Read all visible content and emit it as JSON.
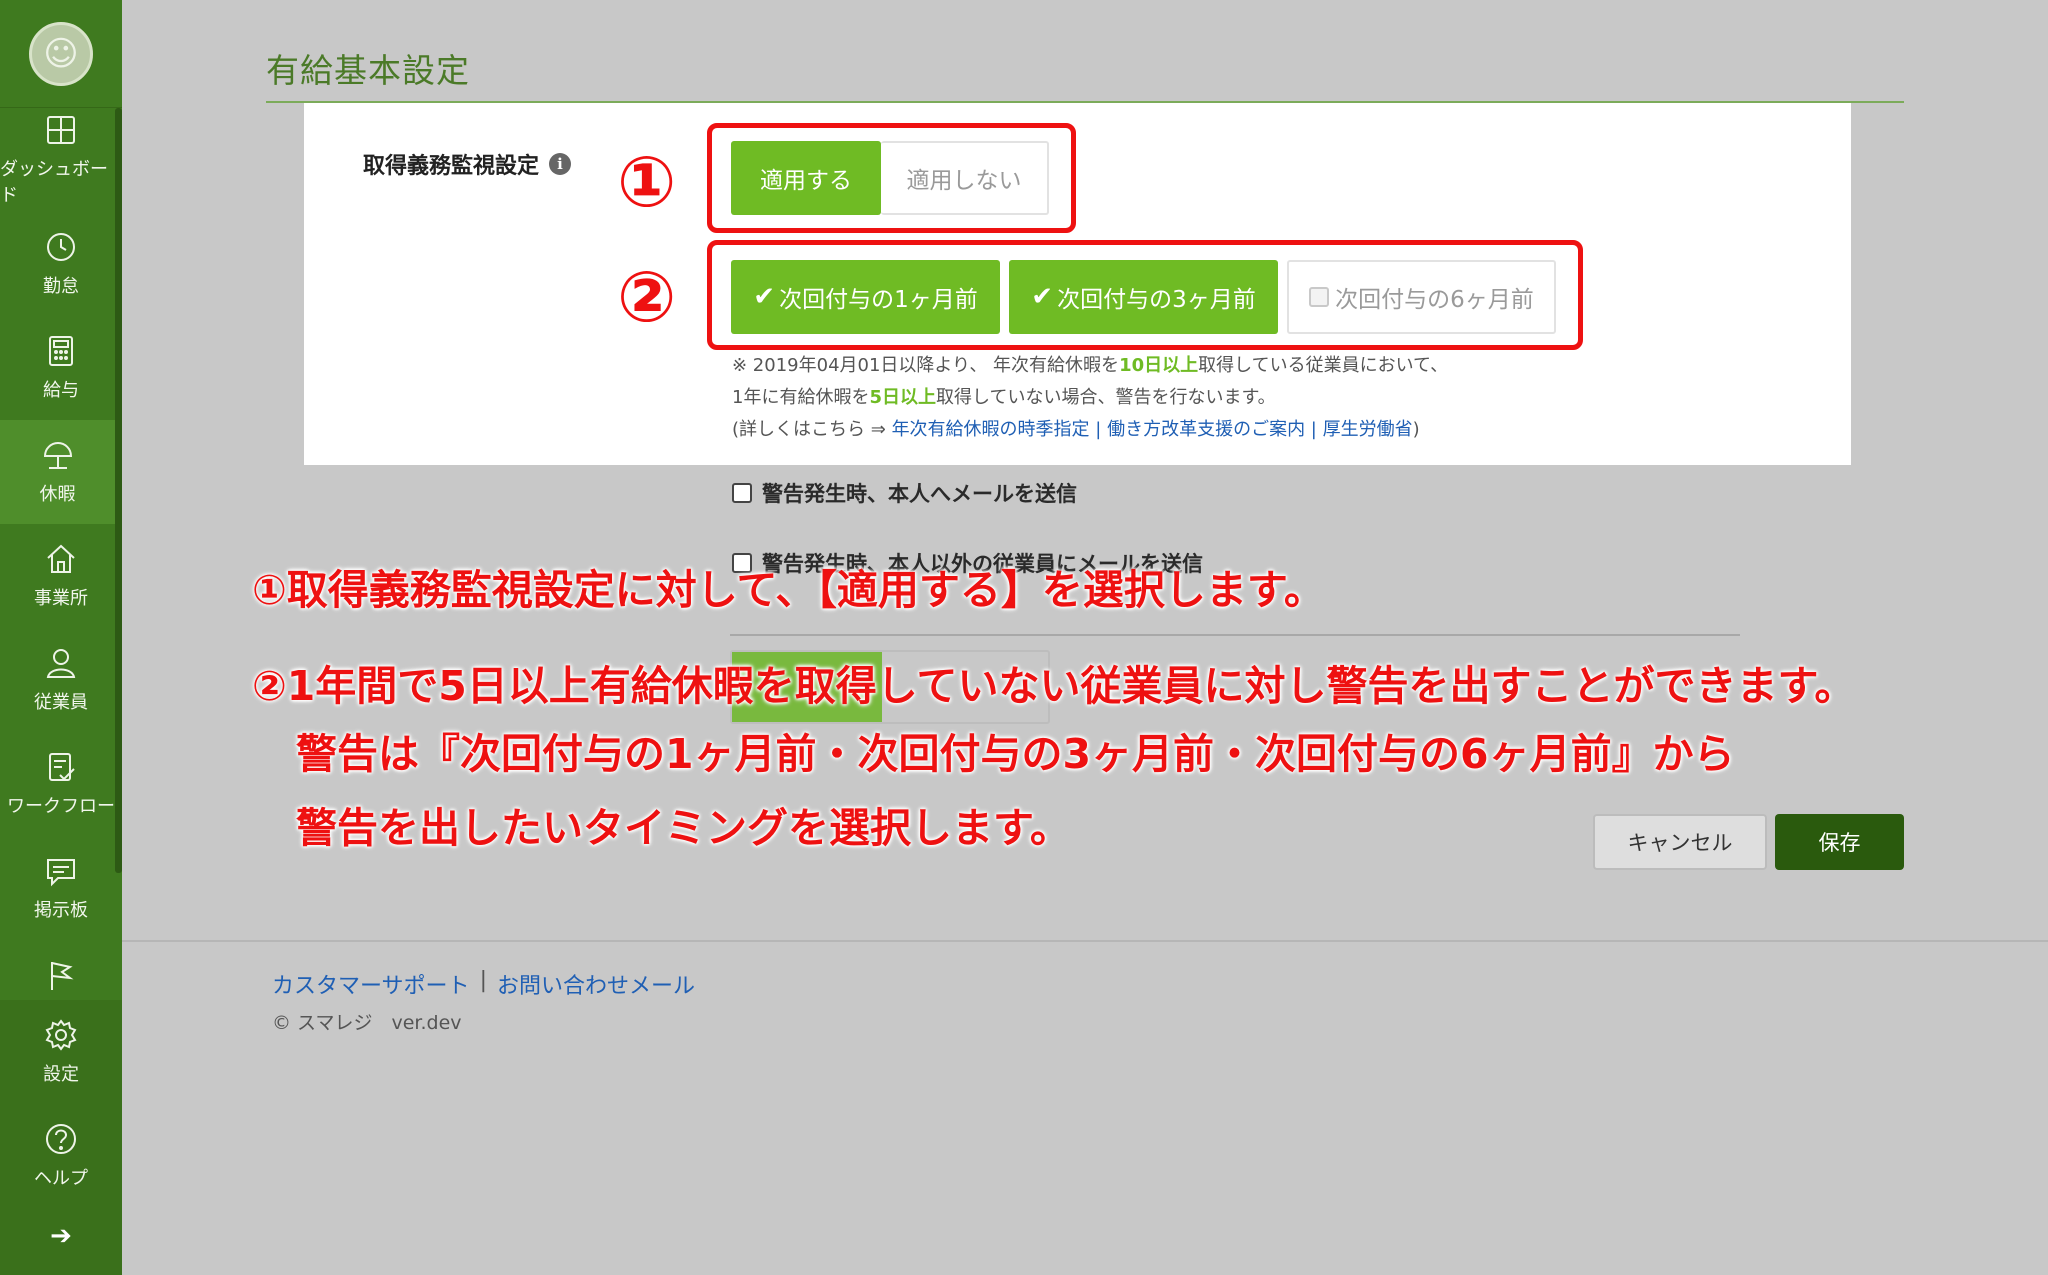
{
  "sidebar": {
    "items": [
      {
        "label": "ダッシュボード",
        "icon": "dashboard-icon"
      },
      {
        "label": "勤怠",
        "icon": "clock-icon"
      },
      {
        "label": "給与",
        "icon": "calculator-icon"
      },
      {
        "label": "休暇",
        "icon": "umbrella-icon"
      },
      {
        "label": "事業所",
        "icon": "home-icon"
      },
      {
        "label": "従業員",
        "icon": "person-icon"
      },
      {
        "label": "ワークフロー",
        "icon": "checklist-icon"
      },
      {
        "label": "掲示板",
        "icon": "message-icon"
      },
      {
        "label": "",
        "icon": "flag-icon"
      },
      {
        "label": "設定",
        "icon": "gear-icon"
      },
      {
        "label": "ヘルプ",
        "icon": "help-icon"
      }
    ],
    "collapse_icon": "arrow-right-icon"
  },
  "page": {
    "title": "有給基本設定"
  },
  "form": {
    "monitor_label": "取得義務監視設定",
    "apply_label": "適用する",
    "not_apply_label": "適用しない",
    "timing": {
      "one_month": "次回付与の1ヶ月前",
      "three_month": "次回付与の3ヶ月前",
      "six_month": "次回付与の6ヶ月前"
    },
    "note": {
      "line1_a": "※ 2019年04月01日以降より、 年次有給休暇を",
      "line1_hl": "10日以上",
      "line1_b": "取得している従業員において、",
      "line2_a": "1年に有給休暇を",
      "line2_hl": "5日以上",
      "line2_b": "取得していない場合、警告を行ないます。",
      "line3_a": "(詳しくはこちら ⇒ ",
      "link1": "年次有給休暇の時季指定",
      "link_sep": " | ",
      "link2": "働き方改革支援のご案内",
      "link3": "厚生労働省",
      "line3_b": ")"
    },
    "mail_self": "警告発生時、本人へメールを送信",
    "mail_others": "警告発生時、本人以外の従業員にメールを送信",
    "cancel": "キャンセル",
    "save": "保存"
  },
  "footer": {
    "support": "カスタマーサポート",
    "sep": "|",
    "contact": "お問い合わせメール",
    "copyright": "© スマレジ　ver.dev"
  },
  "annotations": {
    "num1": "①",
    "num2": "②",
    "line1": "①取得義務監視設定に対して、【適用する】を選択します。",
    "line2": "②1年間で5日以上有給休暇を取得していない従業員に対し警告を出すことができます。",
    "line3": "警告は『次回付与の1ヶ月前・次回付与の3ヶ月前・次回付与の6ヶ月前』から",
    "line4": "警告を出したいタイミングを選択します。"
  },
  "colors": {
    "sidebar": "#3f7a1f",
    "accent_green": "#6fbb24",
    "save_button": "#2a5a0d",
    "annotation_red": "#ee1111",
    "link_blue": "#1f5fb4"
  }
}
